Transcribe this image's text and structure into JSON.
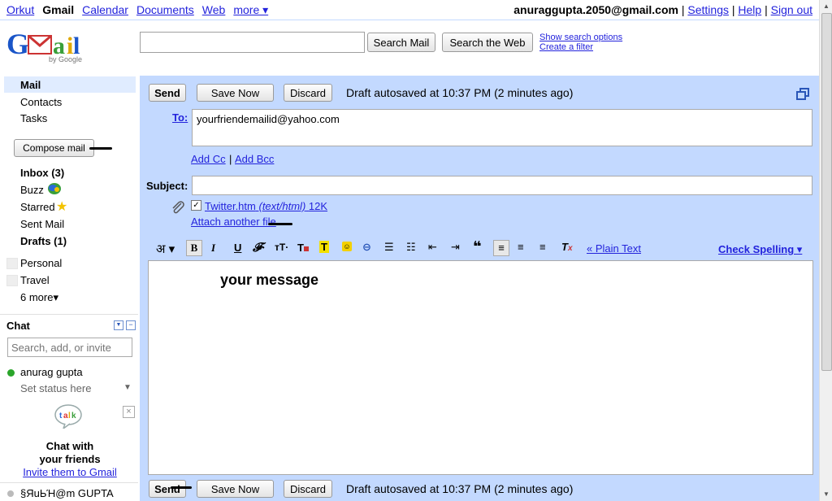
{
  "topnav": {
    "items": [
      "Orkut",
      "Gmail",
      "Calendar",
      "Documents",
      "Web",
      "more ▾"
    ],
    "email": "anuraggupta.2050@gmail.com",
    "links": [
      "Settings",
      "Help",
      "Sign out"
    ]
  },
  "logo": {
    "text": "Gmail",
    "sub": "by Google"
  },
  "search": {
    "value": "",
    "mail_button": "Search Mail",
    "web_button": "Search the Web",
    "options_link": "Show search options",
    "filter_link": "Create a filter"
  },
  "sidebar": {
    "top_items": [
      "Mail",
      "Contacts",
      "Tasks"
    ],
    "compose": "Compose mail",
    "folders": [
      {
        "label": "Inbox (3)",
        "bold": true
      },
      {
        "label": "Buzz",
        "bold": false
      },
      {
        "label": "Starred",
        "bold": false
      },
      {
        "label": "Sent Mail",
        "bold": false
      },
      {
        "label": "Drafts (1)",
        "bold": true
      }
    ],
    "labels": [
      "Personal",
      "Travel"
    ],
    "more": "6 more▾"
  },
  "chat": {
    "title": "Chat",
    "search_placeholder": "Search, add, or invite",
    "user": "anurag gupta",
    "status": "Set status here",
    "promo_line1": "Chat with",
    "promo_line2": "your friends",
    "invite": "Invite them to Gmail",
    "contact": "§ЯuЬΉ@m GUPTA"
  },
  "compose": {
    "send": "Send",
    "save": "Save Now",
    "discard": "Discard",
    "autosave": "Draft autosaved at 10:37 PM (2 minutes ago)",
    "to_label": "To:",
    "to_value": "yourfriendemailid@yahoo.com",
    "add_cc": "Add Cc",
    "add_bcc": "Add Bcc",
    "subject_label": "Subject:",
    "subject_value": "",
    "attachment_name": "Twitter.htm",
    "attachment_type": "(text/html)",
    "attachment_size": "12K",
    "attach_another": "Attach another file",
    "plain_text": "« Plain Text",
    "check_spelling": "Check Spelling ▾",
    "body": "your message",
    "lang_char": "अ"
  },
  "colors": {
    "panel": "#c3d9ff",
    "link": "#2323dc"
  }
}
